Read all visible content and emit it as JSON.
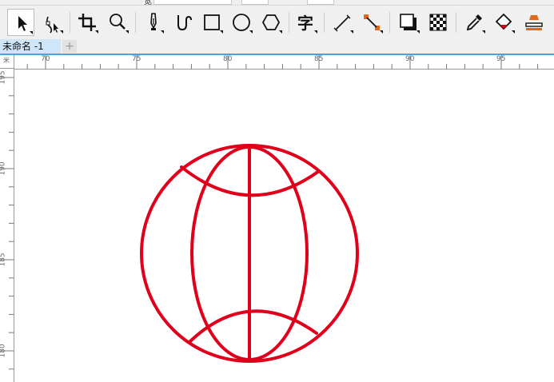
{
  "property_bar": {
    "partial_label": "宽"
  },
  "toolbar": {
    "tools": [
      {
        "name": "pick-tool",
        "icon": "arrow-pointer-icon"
      },
      {
        "name": "shape-tool",
        "icon": "node-edit-icon"
      },
      {
        "name": "crop-tool",
        "icon": "crop-icon"
      },
      {
        "name": "zoom-tool",
        "icon": "magnifier-icon"
      },
      {
        "name": "freehand-tool",
        "icon": "pen-nib-icon"
      },
      {
        "name": "artistic-media-tool",
        "icon": "brush-curve-icon"
      },
      {
        "name": "rectangle-tool",
        "icon": "rectangle-icon"
      },
      {
        "name": "ellipse-tool",
        "icon": "ellipse-icon"
      },
      {
        "name": "polygon-tool",
        "icon": "hexagon-icon"
      },
      {
        "name": "text-tool",
        "icon": "text-glyph-icon",
        "glyph": "字"
      },
      {
        "name": "dimension-tool",
        "icon": "parallel-dimension-icon"
      },
      {
        "name": "connector-tool",
        "icon": "connector-icon"
      },
      {
        "name": "drop-shadow-tool",
        "icon": "drop-shadow-icon"
      },
      {
        "name": "transparency-tool",
        "icon": "checkerboard-icon"
      },
      {
        "name": "color-eyedropper-tool",
        "icon": "eyedropper-icon"
      },
      {
        "name": "interactive-fill-tool",
        "icon": "paint-bucket-icon"
      },
      {
        "name": "smart-fill-tool",
        "icon": "smart-fill-icon"
      }
    ]
  },
  "document_tabs": {
    "active_label": "未命名 -1",
    "add_label": "+"
  },
  "ruler": {
    "corner_label": "米",
    "horizontal_ticks": [
      "70",
      "75",
      "80",
      "85",
      "90",
      "95"
    ],
    "vertical_ticks": [
      "195",
      "190",
      "185",
      "180"
    ]
  },
  "drawing": {
    "shape": "globe",
    "stroke_color": "#e0001b"
  },
  "colors": {
    "accent": "#4aa3df",
    "tab_active": "#cfe6f8",
    "drawing_stroke": "#e0001b"
  }
}
